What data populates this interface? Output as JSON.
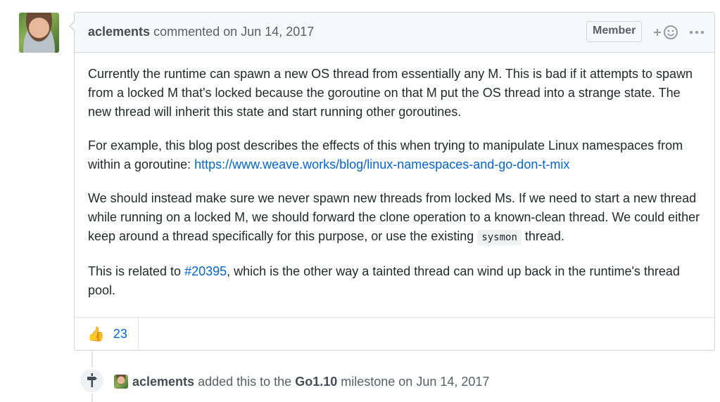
{
  "comment": {
    "author": "aclements",
    "action": "commented on",
    "date": "Jun 14, 2017",
    "badge": "Member",
    "icons": {
      "add_reaction": "smiley-plus-icon",
      "more": "kebab-horizontal-icon"
    },
    "body": {
      "p1": "Currently the runtime can spawn a new OS thread from essentially any M. This is bad if it attempts to spawn from a locked M that's locked because the goroutine on that M put the OS thread into a strange state. The new thread will inherit this state and start running other goroutines.",
      "p2_text": "For example, this blog post describes the effects of this when trying to manipulate Linux namespaces from within a goroutine: ",
      "p2_link": "https://www.weave.works/blog/linux-namespaces-and-go-don-t-mix",
      "p3_text_before": "We should instead make sure we never spawn new threads from locked Ms. If we need to start a new thread while running on a locked M, we should forward the clone operation to a known-clean thread. We could either keep around a thread specifically for this purpose, or use the existing ",
      "p3_code": "sysmon",
      "p3_text_after": " thread.",
      "p4_before": "This is related to ",
      "p4_link": "#20395",
      "p4_after": ", which is the other way a tainted thread can wind up back in the runtime's thread pool."
    },
    "reactions": [
      {
        "emoji": "👍",
        "icon": "thumbs-up-icon",
        "count": "23"
      }
    ]
  },
  "event": {
    "icon": "milestone-icon",
    "author": "aclements",
    "text_mid": "added this to the",
    "milestone": "Go1.10",
    "text_end": "milestone on",
    "date": "Jun 14, 2017"
  },
  "colors": {
    "link": "#0366d6",
    "header_bg": "#f6f8fa",
    "border": "#d1d5da",
    "muted": "#586069"
  }
}
